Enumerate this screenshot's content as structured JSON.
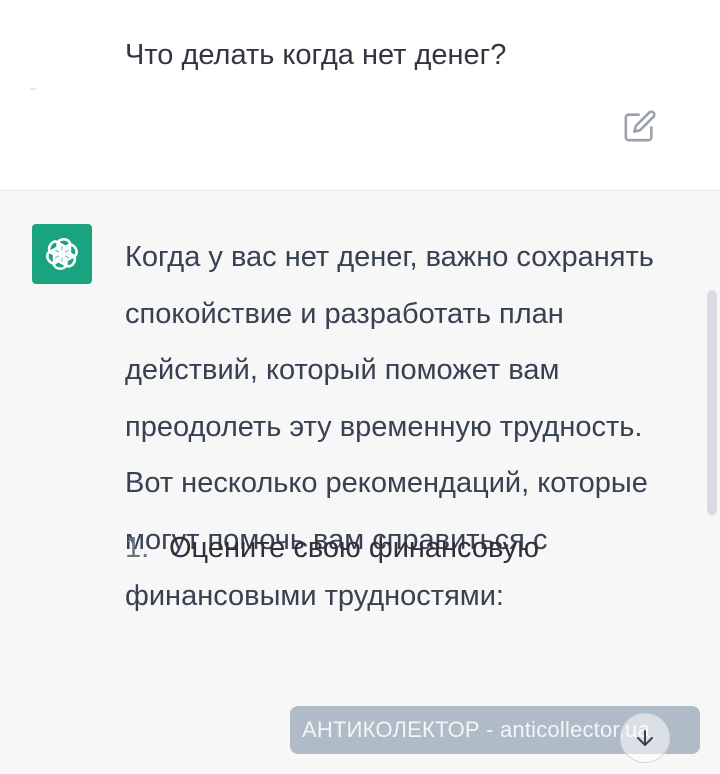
{
  "user_message": {
    "text": "Что делать когда нет денег?"
  },
  "assistant_message": {
    "paragraph": "Когда у вас нет денег, важно сохранять спокойствие и разработать план действий, который поможет вам преодолеть эту временную трудность. Вот несколько рекомендаций, которые могут помочь вам справиться с финансовыми трудностями:",
    "list": [
      {
        "number": "1.",
        "text": "Оцените свою финансовую"
      }
    ]
  },
  "watermark": {
    "text": "АНТИКОЛЕКТОР - anticollector.ua"
  },
  "icons": {
    "edit": "edit-icon",
    "avatar": "openai-logo-icon",
    "scroll_down": "arrow-down-icon"
  },
  "colors": {
    "avatar_bg": "#19a37e",
    "assistant_bg": "#f7f7f8",
    "user_bg": "#ffffff"
  }
}
